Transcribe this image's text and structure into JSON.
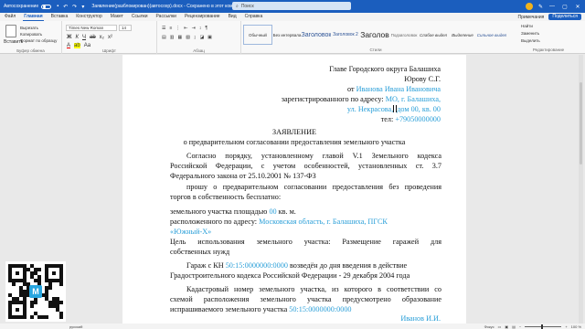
{
  "titlebar": {
    "autosave_label": "Автосохранение",
    "doc_title": "Заявление(разблокирован)(автосохр).docx - Сохранено в этот компьютер",
    "search_placeholder": "Поиск",
    "min_glyph": "—",
    "max_glyph": "▢",
    "close_glyph": "✕"
  },
  "tabs": [
    "Файл",
    "Главная",
    "Вставка",
    "Конструктор",
    "Макет",
    "Ссылки",
    "Рассылки",
    "Рецензирование",
    "Вид",
    "Справка"
  ],
  "tabs_right": {
    "comments": "Примечания",
    "share": "Поделиться"
  },
  "ribbon": {
    "paste": "Вставить",
    "cut": "Вырезать",
    "copy": "Копировать",
    "format_painter": "Формат по образцу",
    "clipboard_label": "Буфер обмена",
    "font_name": "Times New Roman",
    "font_size": "14",
    "font_label": "Шрифт",
    "paragraph_label": "Абзац",
    "styles": [
      "Обычный",
      "Без интервала",
      "Заголовок",
      "Заголовок 2",
      "Заголов",
      "Подзаголовок",
      "Слабое выдел",
      "Выделение",
      "Сильное выдел"
    ],
    "styles_label": "Стили",
    "edit_find": "Найти",
    "edit_replace": "Заменить",
    "edit_select": "Выделить",
    "edit_label": "Редактирование"
  },
  "document": {
    "addressee_line1": "Главе Городского округа Балашиха",
    "addressee_line2": "Юрову С.Г.",
    "from_prefix": "от ",
    "from_name": "Иванова Ивана Ивановича",
    "registered_prefix": "зарегистрированного по адресу: ",
    "registered_addr1": "МО, г. Балашиха,",
    "registered_addr2_a": "ул. Некрасова,",
    "registered_addr2_b": "дом 00, кв. 00",
    "tel_prefix": "тел: ",
    "tel_value": "+79050000000",
    "title": "ЗАЯВЛЕНИЕ",
    "subtitle": "о предварительном согласовании предоставления земельного участка",
    "para1_line1": "Согласно порядку, установленному главой V.1 Земельного кодекса",
    "para1_line2": "Российской Федерации, с учетом особенностей, установленных ст. 3.7",
    "para1_line3": "Федерального закона от 25.10.2001 № 137-ФЗ",
    "para2_line1": "прошу о предварительном согласовании предоставления без проведения",
    "para2_line2": "торгов в собственность бесплатно:",
    "area_prefix": "земельного участка площадью ",
    "area_value": "00",
    "area_suffix": " кв. м.",
    "location_prefix": "расположенного по адресу: ",
    "location_value1": "Московская область, г. Балашиха, ПГСК",
    "location_value2": "«Южный-Х»",
    "purpose_line1": "Цель использования земельного участка: Размещение гаражей для",
    "purpose_line2": "собственных нужд",
    "garage_prefix": "Гараж с КН ",
    "garage_kn": "50:15:0000000:0000",
    "garage_suffix": " возведён до дня введения в действие",
    "garage_line2": "Градостроительного кодекса Российской Федерации - 29 декабря 2004 года",
    "cadastral_line1": "Кадастровый номер земельного участка, из которого в соответствии со",
    "cadastral_line2": "схемой расположения земельного участка предусмотрено образование",
    "cadastral_line3_prefix": "испрашиваемого земельного участка ",
    "cadastral_kn": "50:15:0000000:0000",
    "signature": "Иванов И.И."
  },
  "statusbar": {
    "left": "русский",
    "focus": "Фокус",
    "zoom": "100 %"
  },
  "qr_logo": "М",
  "colors": {
    "accent": "#1b5ebe",
    "link": "#2a9fd8"
  }
}
